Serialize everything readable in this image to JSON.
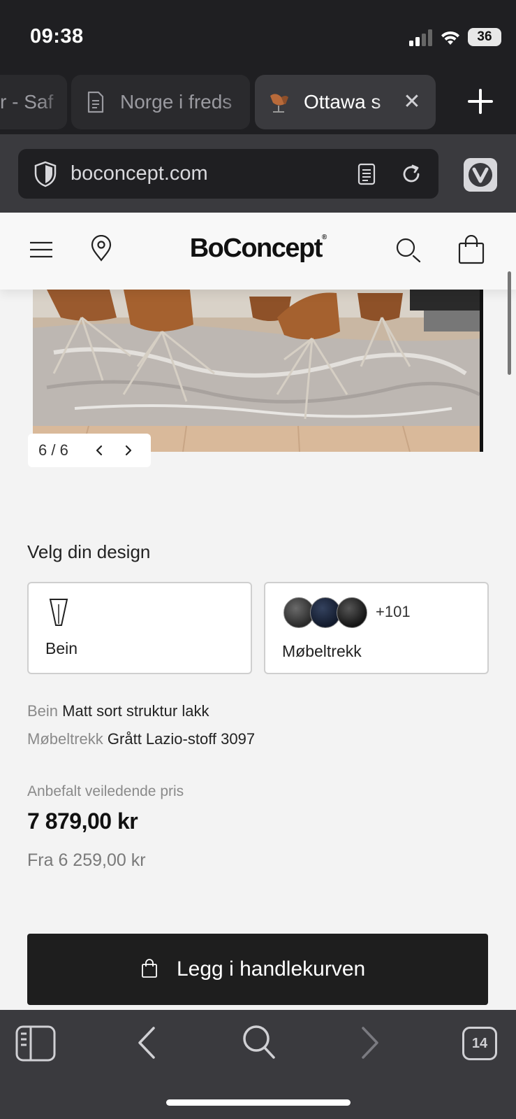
{
  "status_bar": {
    "time": "09:38",
    "battery": "36"
  },
  "tabs": [
    {
      "title": "r - Saf",
      "active": false
    },
    {
      "title": "Norge i freds",
      "active": false,
      "icon": "document-icon"
    },
    {
      "title": "Ottawa s",
      "active": true,
      "icon": "chair-favicon"
    }
  ],
  "address_bar": {
    "url": "boconcept.com"
  },
  "site_header": {
    "logo": "BoConcept",
    "logo_mark": "®"
  },
  "carousel": {
    "counter": "6 / 6"
  },
  "design": {
    "heading": "Velg din design",
    "legs_label": "Bein",
    "fabric_label": "Møbeltrekk",
    "fabric_more": "+101"
  },
  "specs": [
    {
      "key": "Bein",
      "value": "Matt sort struktur lakk"
    },
    {
      "key": "Møbeltrekk",
      "value": "Grått Lazio-stoff 3097"
    }
  ],
  "pricing": {
    "label": "Anbefalt veiledende pris",
    "price": "7 879,00 kr",
    "from": "Fra 6 259,00 kr"
  },
  "cta": {
    "add_to_cart": "Legg i handlekurven"
  },
  "toolbar": {
    "tab_count": "14"
  },
  "colors": {
    "chrome_dark": "#1f1f22",
    "chrome_mid": "#3a3a3e",
    "page_bg": "#f3f3f3",
    "cta_bg": "#1e1e1e"
  }
}
